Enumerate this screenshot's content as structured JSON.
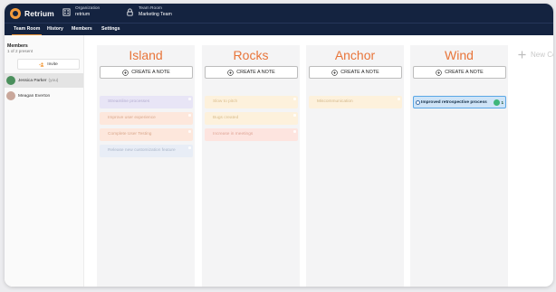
{
  "app": {
    "name": "Retrium"
  },
  "header": {
    "organization": {
      "label": "Organization",
      "value": "retrium"
    },
    "team_room": {
      "label": "Team Room",
      "value": "Marketing Team"
    }
  },
  "tabs": [
    {
      "label": "Team Room",
      "active": true
    },
    {
      "label": "History",
      "active": false
    },
    {
      "label": "Members",
      "active": false
    },
    {
      "label": "Settings",
      "active": false
    }
  ],
  "sidebar": {
    "title": "Members",
    "count": "1 of 2 present",
    "invite_label": "Invite",
    "members": [
      {
        "name": "Jessica Parker",
        "sub": "(you)",
        "selected": true
      },
      {
        "name": "Meagan Everton",
        "sub": "",
        "selected": false
      }
    ]
  },
  "create_note_label": "CREATE A NOTE",
  "columns": [
    {
      "title": "Island",
      "notes": [
        {
          "text": "Streamline processes",
          "color": "#e8e5f6",
          "text_color": "#b4aed0"
        },
        {
          "text": "Improve user experience",
          "color": "#fde7dc",
          "text_color": "#d9a78c"
        },
        {
          "text": "Complete User Testing",
          "color": "#fde7dc",
          "text_color": "#d9a78c"
        },
        {
          "text": "Release new customization feature",
          "color": "#e8edf6",
          "text_color": "#aab6c9"
        }
      ]
    },
    {
      "title": "Rocks",
      "notes": [
        {
          "text": "Slow to pitch",
          "color": "#fdf1dc",
          "text_color": "#d9bd8c"
        },
        {
          "text": "Bugs created",
          "color": "#fdf1dc",
          "text_color": "#d9bd8c"
        },
        {
          "text": "Increase in meetings",
          "color": "#fde4df",
          "text_color": "#dfa596"
        }
      ]
    },
    {
      "title": "Anchor",
      "notes": [
        {
          "text": "Miscommunication",
          "color": "#fdf1dc",
          "text_color": "#d3b88a"
        }
      ]
    },
    {
      "title": "Wind",
      "notes": [
        {
          "text": "Improved retrospective process",
          "color": "#cfe4f7",
          "text_color": "#102a43",
          "active": true,
          "votes": "1"
        }
      ]
    }
  ],
  "new_column_label": "New Co",
  "colors": {
    "navy": "#142340",
    "accent": "#f29a3c",
    "title_orange": "#e8753a",
    "vote_green": "#3db67a"
  }
}
